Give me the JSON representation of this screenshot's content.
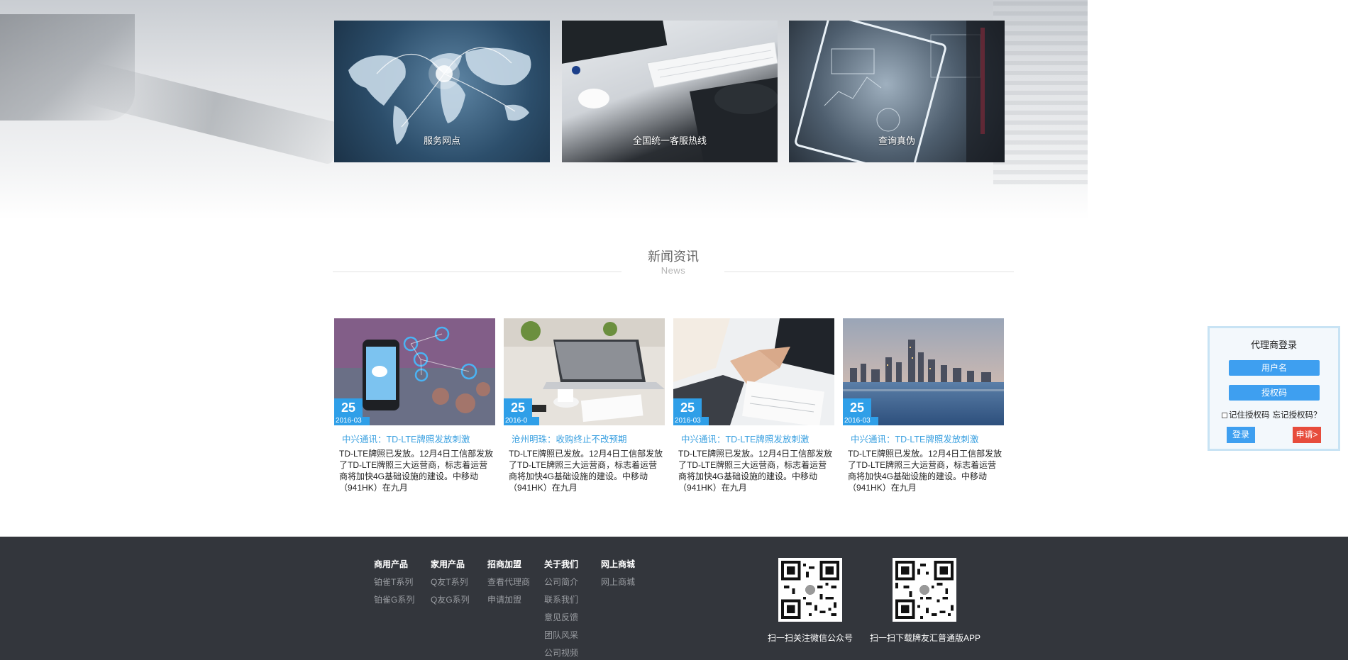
{
  "hero": {
    "tiles": [
      {
        "label": "服务网点"
      },
      {
        "label": "全国统一客服热线"
      },
      {
        "label": "查询真伪"
      }
    ]
  },
  "news": {
    "title": "新闻资讯",
    "subtitle": "News",
    "cards": [
      {
        "day": "25",
        "month": "2016-03",
        "title": "中兴通讯：TD-LTE牌照发放刺激",
        "desc": "TD-LTE牌照已发放。12月4日工信部发放了TD-LTE牌照三大运营商，标志着运营商将加快4G基础设施的建设。中移动（941HK）在九月"
      },
      {
        "day": "25",
        "month": "2016-0",
        "title": "沧州明珠：收购终止不改预期",
        "desc": "TD-LTE牌照已发放。12月4日工信部发放了TD-LTE牌照三大运营商，标志着运营商将加快4G基础设施的建设。中移动（941HK）在九月"
      },
      {
        "day": "25",
        "month": "2016-03",
        "title": "中兴通讯：TD-LTE牌照发放刺激",
        "desc": "TD-LTE牌照已发放。12月4日工信部发放了TD-LTE牌照三大运营商，标志着运营商将加快4G基础设施的建设。中移动（941HK）在九月"
      },
      {
        "day": "25",
        "month": "2016-03",
        "title": "中兴通讯：TD-LTE牌照发放刺激",
        "desc": "TD-LTE牌照已发放。12月4日工信部发放了TD-LTE牌照三大运营商，标志着运营商将加快4G基础设施的建设。中移动（941HK）在九月"
      }
    ]
  },
  "login": {
    "title": "代理商登录",
    "username_placeholder": "用户名",
    "password_placeholder": "授权码",
    "remember": "记住授权码",
    "forgot": "忘记授权码？",
    "login_btn": "登录",
    "apply_btn": "申请>"
  },
  "footer": {
    "columns": [
      {
        "heading": "商用产品",
        "items": [
          "铂雀T系列",
          "铂雀G系列"
        ]
      },
      {
        "heading": "家用产品",
        "items": [
          "Q友T系列",
          "Q友G系列"
        ]
      },
      {
        "heading": "招商加盟",
        "items": [
          "查看代理商",
          "申请加盟"
        ]
      },
      {
        "heading": "关于我们",
        "items": [
          "公司简介",
          "联系我们",
          "意见反馈",
          "团队风采",
          "公司视频"
        ]
      },
      {
        "heading": "网上商城",
        "items": [
          "网上商城"
        ]
      }
    ],
    "qr": [
      {
        "caption": "扫一扫关注微信公众号"
      },
      {
        "caption": "扫一扫下载牌友汇普通版APP"
      }
    ]
  },
  "colors": {
    "accent": "#2f9fe8",
    "apply_red": "#e74c3c",
    "footer_bg": "#33363c",
    "title_blue": "#3aa0e0"
  }
}
